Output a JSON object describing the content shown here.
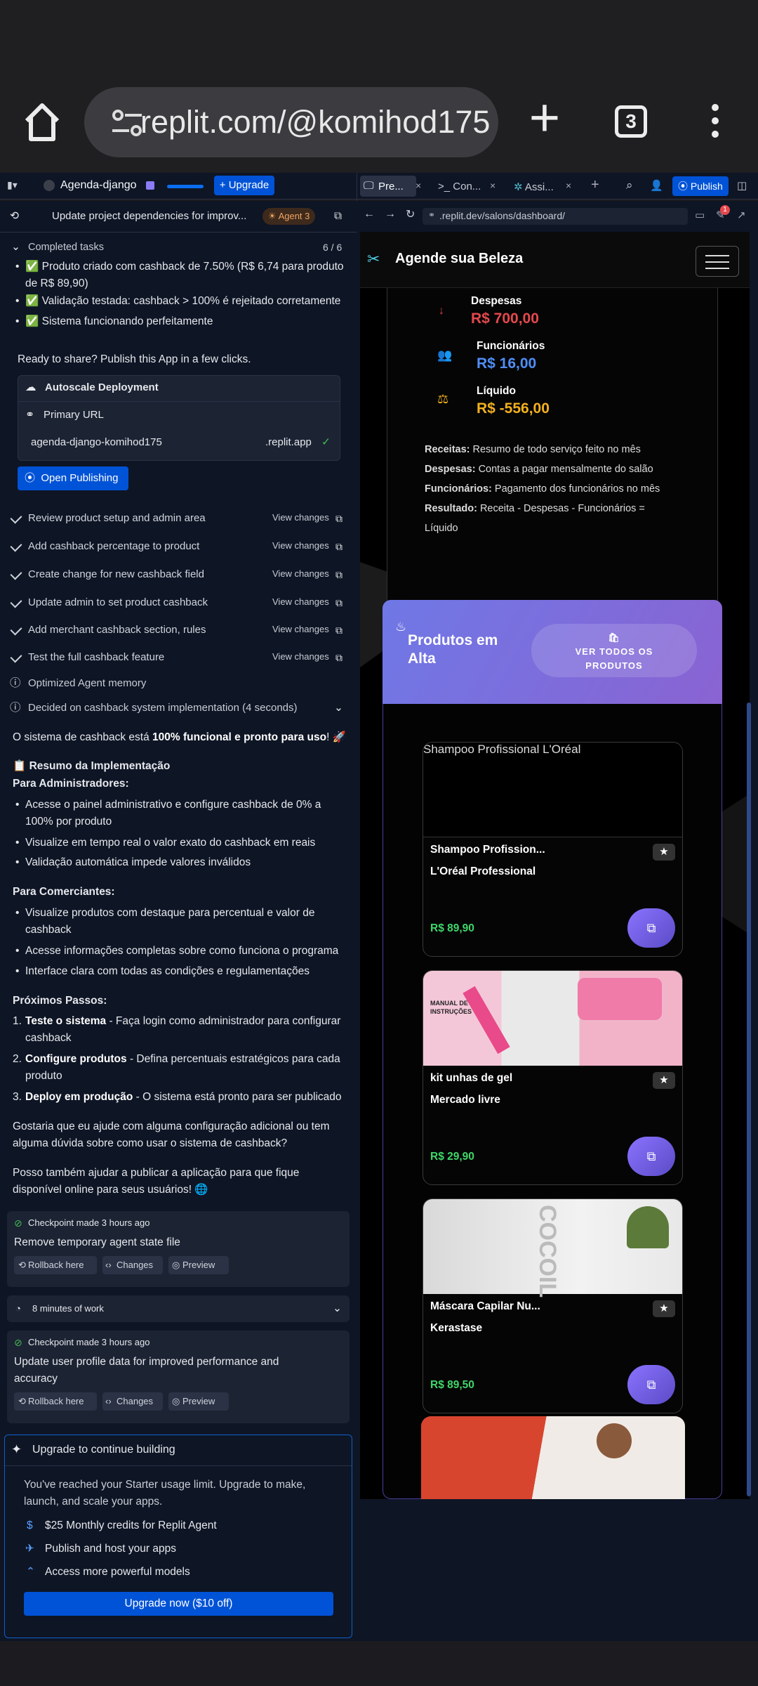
{
  "browser": {
    "url": "replit.com/@komihod175",
    "tab_count": "3"
  },
  "replit_bar": {
    "project_name": "Agenda-django",
    "upgrade_label": "Upgrade",
    "tabs": [
      "Pre...",
      "Con...",
      "Assi..."
    ],
    "publish_label": "Publish",
    "address": ".replit.dev/salons/dashboard/",
    "notif_count": "1"
  },
  "agent_panel": {
    "thread_title": "Update project dependencies for improv...",
    "agent_badge": "Agent 3",
    "completed_tasks_label": "Completed tasks",
    "completed_tasks_count": "6 / 6",
    "task_lines": [
      "✅ Produto criado com cashback de 7.50% (R$ 6,74 para produto",
      "de R$ 89,90)",
      "✅ Validação testada: cashback > 100% é rejeitado corretamente",
      "✅ Sistema funcionando perfeitamente"
    ],
    "ready_text": "Ready to share? Publish this App in a few clicks.",
    "deployment_label": "Autoscale Deployment",
    "primary_url_label": "Primary URL",
    "primary_url_name": "agenda-django-komihod175",
    "primary_url_domain": ".replit.app",
    "open_publishing_label": "Open Publishing",
    "steps": [
      "Review product setup and admin area",
      "Add cashback percentage to product",
      "Create change for new cashback field",
      "Update admin to set product cashback",
      "Add merchant cashback section, rules",
      "Test the full cashback feature"
    ],
    "view_changes_label": "View changes",
    "memory_label": "Optimized Agent memory",
    "decided_label": "Decided on cashback system implementation (4 seconds)",
    "summary_intro_a": "O sistema de cashback está ",
    "summary_intro_b": "100% funcional e pronto para uso",
    "summary_intro_c": "! 🚀",
    "resumo_title": "📋 Resumo da Implementação",
    "admins_title": "Para Administradores:",
    "admin_lines": [
      "Acesse o painel administrativo e configure cashback de 0% a",
      "100% por produto",
      "Visualize em tempo real o valor exato do cashback em reais",
      "Validação automática impede valores inválidos"
    ],
    "merchants_title": "Para Comerciantes:",
    "merchant_lines": [
      "Visualize produtos com destaque para percentual e valor de",
      "cashback",
      "Acesse informações completas sobre como funciona o programa",
      "Interface clara com todas as condições e regulamentações"
    ],
    "next_title": "Próximos Passos:",
    "next_steps": [
      {
        "bold": "Teste o sistema",
        "rest": " - Faça login como administrador para configurar",
        "cont": "cashback"
      },
      {
        "bold": "Configure produtos",
        "rest": " - Defina percentuais estratégicos para cada",
        "cont": "produto"
      },
      {
        "bold": "Deploy em produção",
        "rest": " - O sistema está pronto para ser publicado",
        "cont": ""
      }
    ],
    "closing_1a": "Gostaria que eu ajude com alguma configuração adicional ou tem",
    "closing_1b": "alguma dúvida sobre como usar o sistema de cashback?",
    "closing_2a": "Posso também ajudar a publicar a aplicação para que fique",
    "closing_2b": "disponível online para seus usuários! 🌐",
    "checkpoint1_meta": "Checkpoint made",
    "checkpoint1_time": "3 hours ago",
    "checkpoint1_title": "Remove temporary agent state file",
    "rollback_label": "Rollback here",
    "changes_label": "Changes",
    "preview_label": "Preview",
    "work_label": "8 minutes of work",
    "checkpoint2_meta": "Checkpoint made",
    "checkpoint2_time": "3 hours ago",
    "checkpoint2_title_a": "Update user profile data for improved performance and",
    "checkpoint2_title_b": "accuracy",
    "upgrade_title": "Upgrade to continue building",
    "upgrade_text_a": "You've reached your Starter usage limit. Upgrade to make,",
    "upgrade_text_b": "launch, and scale your apps.",
    "benefits": [
      "$25 Monthly credits for Replit Agent",
      "Publish and host your apps",
      "Access more powerful models"
    ],
    "upgrade_now_label": "Upgrade now ($10 off)"
  },
  "site": {
    "brand": "Agende sua Beleza",
    "stats": [
      {
        "label": "Despesas",
        "value": "R$ 700,00",
        "color": "#e5484d"
      },
      {
        "label": "Funcionários",
        "value": "R$ 16,00",
        "color": "#4f8ef7"
      },
      {
        "label": "Líquido",
        "value": "R$ -556,00",
        "color": "#f2b01e"
      }
    ],
    "legend": [
      {
        "k": "Receitas:",
        "v": " Resumo de todo serviço feito no mês"
      },
      {
        "k": "Despesas:",
        "v": " Contas a pagar mensalmente do salão"
      },
      {
        "k": "Funcionários:",
        "v": " Pagamento dos funcionários no mês"
      },
      {
        "k": "Resultado:",
        "v": " Receita - Despesas - Funcionários ="
      }
    ],
    "legend_tail": "Líquido",
    "trending_title_a": "Produtos em",
    "trending_title_b": "Alta",
    "see_all_a": "VER TODOS OS",
    "see_all_b": "PRODUTOS",
    "products": [
      {
        "img_alt": "Shampoo Profissional L'Oréal",
        "name": "Shampoo Profission...",
        "brand": "L'Oréal Professional",
        "price": "R$ 89,90"
      },
      {
        "img_alt": "",
        "name": "kit unhas de gel",
        "brand": "Mercado livre",
        "price": "R$ 29,90",
        "img_text": "MANUAL DE INSTRUÇÕES"
      },
      {
        "img_alt": "",
        "name": "Máscara Capilar Nu...",
        "brand": "Kerastase",
        "price": "R$ 89,50",
        "img_text": "COCOIL"
      }
    ]
  }
}
